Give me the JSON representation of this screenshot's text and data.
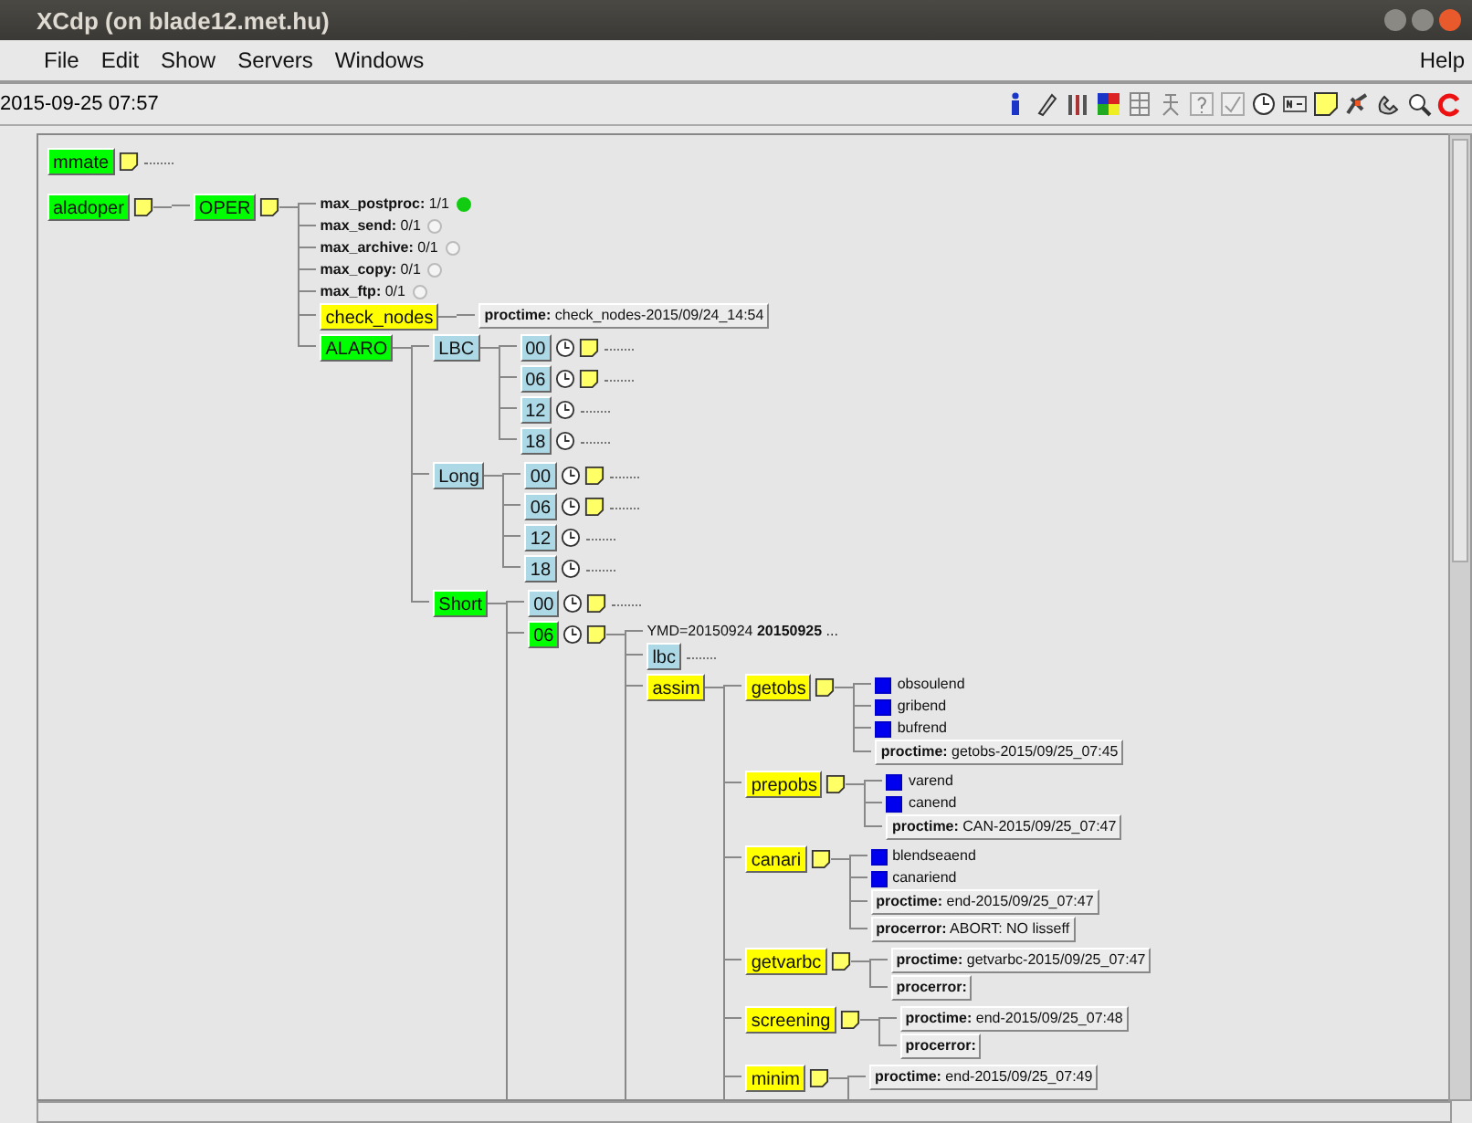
{
  "window": {
    "title": "XCdp (on blade12.met.hu)"
  },
  "menu": [
    "File",
    "Edit",
    "Show",
    "Servers",
    "Windows"
  ],
  "help_menu": "Help",
  "timestamp": "2015-09-25 07:57",
  "tree": [
    {
      "kind": "node",
      "label": "mmate",
      "color": "#00ff00",
      "note": true,
      "clock": false,
      "collapsed": true
    },
    {
      "kind": "node",
      "label": "aladoper",
      "color": "#00ff00",
      "note": true,
      "clock": false,
      "collapsed": false,
      "continues": false,
      "children": [
        {
          "kind": "node",
          "label": "OPER",
          "color": "#00ff00",
          "note": true,
          "clock": false,
          "collapsed": false,
          "continues": false,
          "children": [
            {
              "kind": "limit",
              "name": "max_postproc:",
              "value": "1/1",
              "in_use": true
            },
            {
              "kind": "limit",
              "name": "max_send:",
              "value": "0/1",
              "in_use": false
            },
            {
              "kind": "limit",
              "name": "max_archive:",
              "value": "0/1",
              "in_use": false
            },
            {
              "kind": "limit",
              "name": "max_copy:",
              "value": "0/1",
              "in_use": false
            },
            {
              "kind": "limit",
              "name": "max_ftp:",
              "value": "0/1",
              "in_use": false
            },
            {
              "kind": "node",
              "label": "check_nodes",
              "color": "#ffff00",
              "note": false,
              "clock": false,
              "collapsed": false,
              "continues": false,
              "children": [
                {
                  "kind": "label",
                  "name": "proctime:",
                  "value": "check_nodes-2015/09/24_14:54"
                }
              ]
            },
            {
              "kind": "node",
              "label": "ALARO",
              "color": "#00ff00",
              "note": false,
              "clock": false,
              "collapsed": false,
              "continues": false,
              "children": [
                {
                  "kind": "node",
                  "label": "LBC",
                  "color": "#add8e6",
                  "note": false,
                  "clock": false,
                  "collapsed": false,
                  "continues": false,
                  "children": [
                    {
                      "kind": "node",
                      "label": "00",
                      "color": "#add8e6",
                      "note": true,
                      "clock": true,
                      "collapsed": true
                    },
                    {
                      "kind": "node",
                      "label": "06",
                      "color": "#add8e6",
                      "note": true,
                      "clock": true,
                      "collapsed": true
                    },
                    {
                      "kind": "node",
                      "label": "12",
                      "color": "#add8e6",
                      "note": false,
                      "clock": true,
                      "collapsed": true
                    },
                    {
                      "kind": "node",
                      "label": "18",
                      "color": "#add8e6",
                      "note": false,
                      "clock": true,
                      "collapsed": true
                    }
                  ]
                },
                {
                  "kind": "node",
                  "label": "Long",
                  "color": "#add8e6",
                  "note": false,
                  "clock": false,
                  "collapsed": false,
                  "continues": false,
                  "children": [
                    {
                      "kind": "node",
                      "label": "00",
                      "color": "#add8e6",
                      "note": true,
                      "clock": true,
                      "collapsed": true
                    },
                    {
                      "kind": "node",
                      "label": "06",
                      "color": "#add8e6",
                      "note": true,
                      "clock": true,
                      "collapsed": true
                    },
                    {
                      "kind": "node",
                      "label": "12",
                      "color": "#add8e6",
                      "note": false,
                      "clock": true,
                      "collapsed": true
                    },
                    {
                      "kind": "node",
                      "label": "18",
                      "color": "#add8e6",
                      "note": false,
                      "clock": true,
                      "collapsed": true
                    }
                  ]
                },
                {
                  "kind": "node",
                  "label": "Short",
                  "color": "#00ff00",
                  "note": false,
                  "clock": false,
                  "collapsed": false,
                  "continues": true,
                  "children": [
                    {
                      "kind": "node",
                      "label": "00",
                      "color": "#add8e6",
                      "note": true,
                      "clock": true,
                      "collapsed": true
                    },
                    {
                      "kind": "node",
                      "label": "06",
                      "color": "#00ff00",
                      "note": true,
                      "clock": true,
                      "collapsed": false,
                      "continues": true,
                      "children": [
                        {
                          "kind": "text",
                          "text": "YMD=20150924 **20150925** ..."
                        },
                        {
                          "kind": "node",
                          "label": "lbc",
                          "color": "#add8e6",
                          "note": false,
                          "clock": false,
                          "collapsed": true
                        },
                        {
                          "kind": "node",
                          "label": "assim",
                          "color": "#ffff00",
                          "note": false,
                          "clock": false,
                          "collapsed": false,
                          "continues": true,
                          "children": [
                            {
                              "kind": "node",
                              "label": "getobs",
                              "color": "#ffff00",
                              "note": true,
                              "clock": false,
                              "collapsed": false,
                              "continues": false,
                              "children": [
                                {
                                  "kind": "event",
                                  "label": "obsoulend",
                                  "set": true
                                },
                                {
                                  "kind": "event",
                                  "label": "gribend",
                                  "set": true
                                },
                                {
                                  "kind": "event",
                                  "label": "bufrend",
                                  "set": true
                                },
                                {
                                  "kind": "label",
                                  "name": "proctime:",
                                  "value": "getobs-2015/09/25_07:45"
                                }
                              ]
                            },
                            {
                              "kind": "node",
                              "label": "prepobs",
                              "color": "#ffff00",
                              "note": true,
                              "clock": false,
                              "collapsed": false,
                              "continues": false,
                              "children": [
                                {
                                  "kind": "event",
                                  "label": "varend",
                                  "set": true
                                },
                                {
                                  "kind": "event",
                                  "label": "canend",
                                  "set": true
                                },
                                {
                                  "kind": "label",
                                  "name": "proctime:",
                                  "value": "CAN-2015/09/25_07:47"
                                }
                              ]
                            },
                            {
                              "kind": "node",
                              "label": "canari",
                              "color": "#ffff00",
                              "note": true,
                              "clock": false,
                              "collapsed": false,
                              "continues": false,
                              "children": [
                                {
                                  "kind": "event",
                                  "label": "blendseaend",
                                  "set": true
                                },
                                {
                                  "kind": "event",
                                  "label": "canariend",
                                  "set": true
                                },
                                {
                                  "kind": "label",
                                  "name": "proctime:",
                                  "value": "end-2015/09/25_07:47"
                                },
                                {
                                  "kind": "label",
                                  "name": "procerror:",
                                  "value": "ABORT: NO lisseff"
                                }
                              ]
                            },
                            {
                              "kind": "node",
                              "label": "getvarbc",
                              "color": "#ffff00",
                              "note": true,
                              "clock": false,
                              "collapsed": false,
                              "continues": false,
                              "children": [
                                {
                                  "kind": "label",
                                  "name": "proctime:",
                                  "value": "getvarbc-2015/09/25_07:47"
                                },
                                {
                                  "kind": "label",
                                  "name": "procerror:"
                                }
                              ]
                            },
                            {
                              "kind": "node",
                              "label": "screening",
                              "color": "#ffff00",
                              "note": true,
                              "clock": false,
                              "collapsed": false,
                              "continues": false,
                              "children": [
                                {
                                  "kind": "label",
                                  "name": "proctime:",
                                  "value": "end-2015/09/25_07:48"
                                },
                                {
                                  "kind": "label",
                                  "name": "procerror:"
                                }
                              ]
                            },
                            {
                              "kind": "node",
                              "label": "minim",
                              "color": "#ffff00",
                              "note": true,
                              "clock": false,
                              "collapsed": false,
                              "continues": true,
                              "children": [
                                {
                                  "kind": "label",
                                  "name": "proctime:",
                                  "value": "end-2015/09/25_07:49"
                                }
                              ]
                            }
                          ]
                        }
                      ]
                    }
                  ]
                }
              ]
            }
          ]
        }
      ]
    }
  ]
}
